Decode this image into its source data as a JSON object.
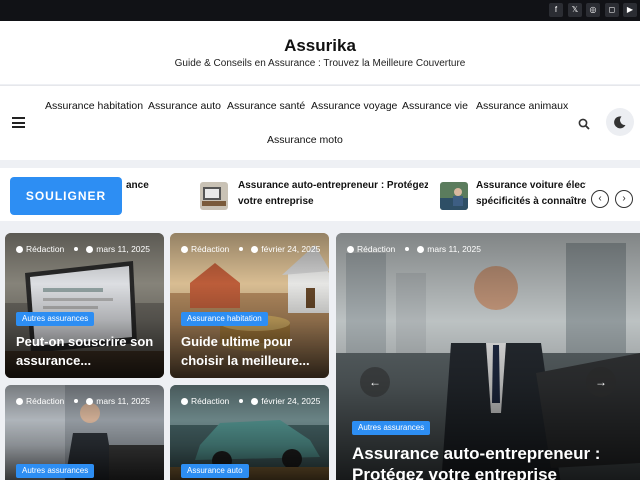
{
  "social": {
    "icons": [
      "facebook-icon",
      "x-icon",
      "dribbble-icon",
      "instagram-icon",
      "youtube-icon"
    ],
    "glyphs": [
      "f",
      "𝕏",
      "◎",
      "◻",
      "▶"
    ]
  },
  "site": {
    "title": "Assurika",
    "tagline": "Guide & Conseils en Assurance : Trouvez la Meilleure Couverture"
  },
  "nav": {
    "items": [
      "Assurance habitation",
      "Assurance auto",
      "Assurance santé",
      "Assurance voyage",
      "Assurance vie",
      "Assurance animaux",
      "Assurance moto"
    ]
  },
  "ticker": {
    "label": "SOULIGNER",
    "items": [
      {
        "title": "ance",
        "line2": ""
      },
      {
        "title": "Assurance auto-entrepreneur : Protégez",
        "line2": "votre entreprise"
      },
      {
        "title": "Assurance voiture électrique :",
        "line2": "spécificités à connaître"
      }
    ],
    "prev": "‹",
    "next": "›"
  },
  "cards": [
    {
      "author": "Rédaction",
      "date": "mars 11, 2025",
      "category": "Autres assurances",
      "title_l1": "Peut-on souscrire son",
      "title_l2": "assurance..."
    },
    {
      "author": "Rédaction",
      "date": "février 24, 2025",
      "category": "Assurance habitation",
      "title_l1": "Guide ultime pour",
      "title_l2": "choisir la meilleure..."
    },
    {
      "author": "Rédaction",
      "date": "mars 11, 2025",
      "category": "Autres assurances",
      "title_l1": "",
      "title_l2": ""
    },
    {
      "author": "Rédaction",
      "date": "février 24, 2025",
      "category": "Assurance auto",
      "title_l1": "",
      "title_l2": ""
    }
  ],
  "hero": {
    "author": "Rédaction",
    "date": "mars 11, 2025",
    "category": "Autres assurances",
    "title_l1": "Assurance auto-entrepreneur :",
    "title_l2": "Protégez votre entreprise",
    "prev": "←",
    "next": "→"
  },
  "colors": {
    "accent": "#2d8ef3",
    "topbar": "#111216"
  }
}
